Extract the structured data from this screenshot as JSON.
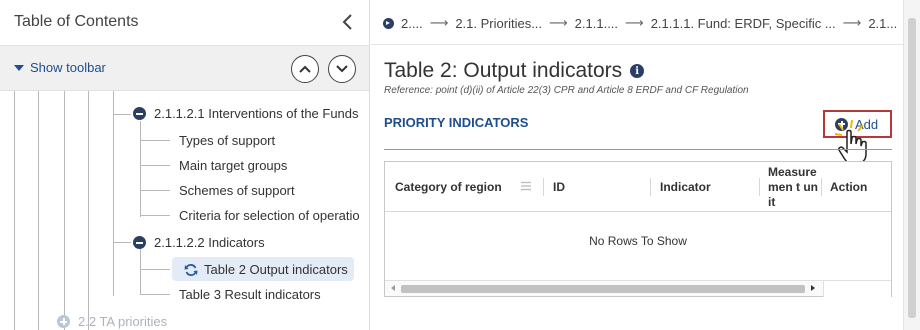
{
  "toc": {
    "title": "Table of Contents",
    "show_toolbar": "Show toolbar",
    "items": [
      {
        "label": "2.1.1.2.1 Interventions of the Funds"
      },
      {
        "label": "Types of support"
      },
      {
        "label": "Main target groups"
      },
      {
        "label": "Schemes of support"
      },
      {
        "label": "Criteria for selection of operatio"
      },
      {
        "label": "2.1.1.2.2 Indicators"
      },
      {
        "label": "Table 2 Output indicators"
      },
      {
        "label": "Table 3 Result indicators"
      },
      {
        "label": "2.2 TA priorities"
      }
    ]
  },
  "breadcrumb": {
    "items": [
      "2....",
      "2.1. Priorities...",
      "2.1.1....",
      "2.1.1.1. Fund: ERDF, Specific ...",
      "2.1..."
    ]
  },
  "main": {
    "title": "Table 2: Output indicators",
    "reference": "Reference: point (d)(ii) of Article 22(3) CPR and Article 8 ERDF and CF Regulation",
    "section_label": "PRIORITY INDICATORS",
    "add_label": "Add"
  },
  "grid": {
    "columns": [
      "Category of region",
      "ID",
      "Indicator",
      "Measuremen t unit",
      "Action"
    ],
    "empty_text": "No Rows To Show"
  },
  "colors": {
    "accent": "#1f4e8c",
    "badge": "#2b3e64",
    "highlight_border": "#b23a3a",
    "selected_bg": "#e3ebf6"
  }
}
